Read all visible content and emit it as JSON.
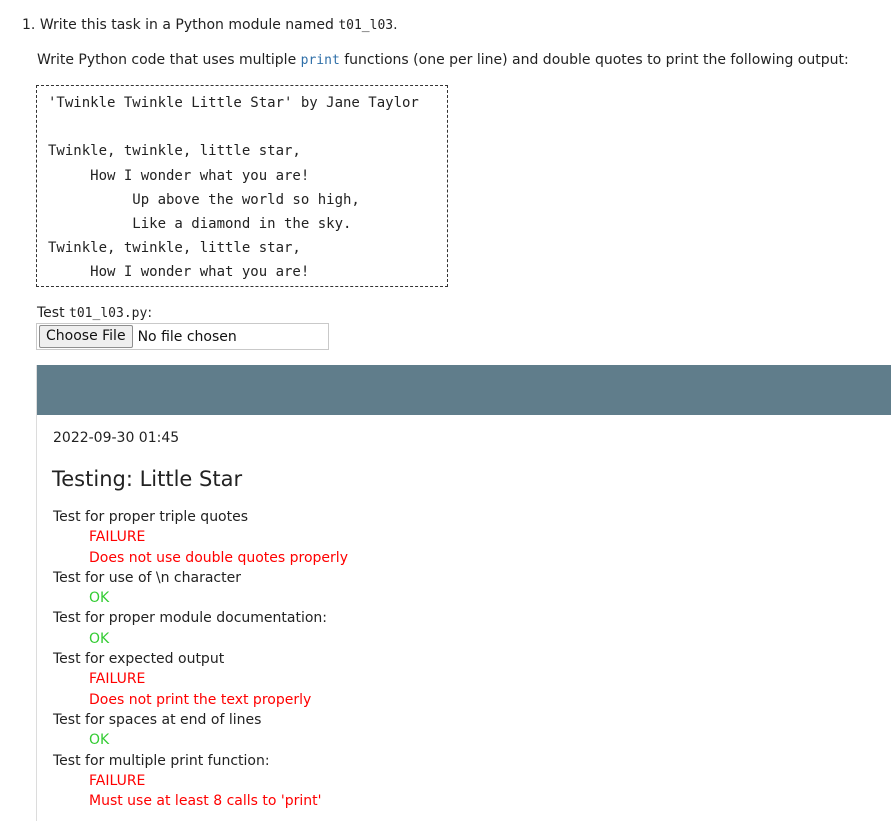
{
  "task": {
    "number": "1.",
    "heading_prefix": "Write this task in a Python module named",
    "module_name": "t01_l03",
    "heading_suffix": ".",
    "instructions_prefix": "Write Python code that uses multiple",
    "instructions_code": "print",
    "instructions_suffix": "functions (one per line) and double quotes to print the following output:",
    "expected_output": "'Twinkle Twinkle Little Star' by Jane Taylor\n\nTwinkle, twinkle, little star,\n     How I wonder what you are!\n          Up above the world so high,\n          Like a diamond in the sky.\nTwinkle, twinkle, little star,\n     How I wonder what you are!"
  },
  "test_upload": {
    "label_prefix": "Test",
    "filename": "t01_l03.py",
    "label_suffix": ":",
    "choose_button": "Choose File",
    "file_status": "No file chosen"
  },
  "results": {
    "timestamp": "2022-09-30 01:45",
    "title": "Testing: Little Star",
    "colors": {
      "header": "#607d8b",
      "failure": "#ff0000",
      "ok": "#33cc33"
    },
    "tests": [
      {
        "name": "Test for proper triple quotes",
        "status": "FAILURE",
        "message": "Does not use double quotes properly"
      },
      {
        "name": "Test for use of \\n character",
        "status": "OK",
        "message": ""
      },
      {
        "name": "Test for proper module documentation:",
        "status": "OK",
        "message": ""
      },
      {
        "name": "Test for expected output",
        "status": "FAILURE",
        "message": "Does not print the text properly"
      },
      {
        "name": "Test for spaces at end of lines",
        "status": "OK",
        "message": ""
      },
      {
        "name": "Test for multiple print function:",
        "status": "FAILURE",
        "message": "Must use at least 8 calls to 'print'"
      }
    ]
  }
}
